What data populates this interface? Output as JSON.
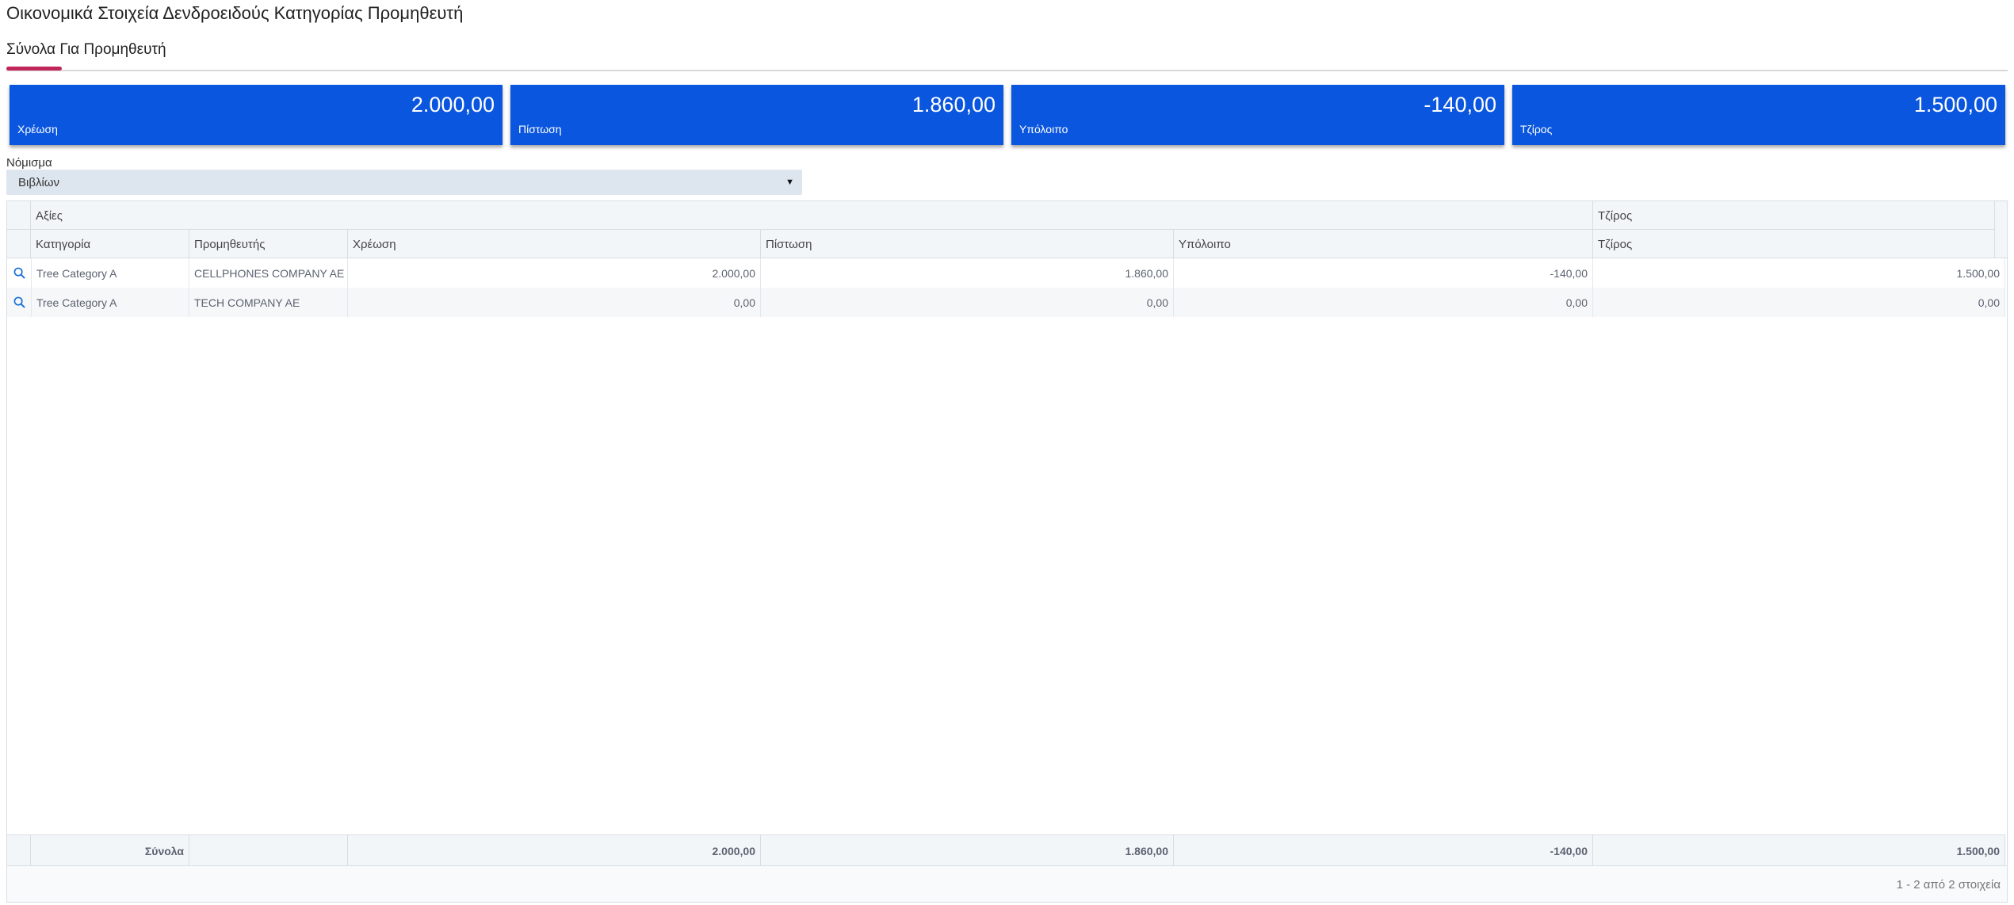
{
  "page": {
    "title": "Οικονομικά Στοιχεία Δενδροειδούς Κατηγορίας Προμηθευτή"
  },
  "tabs": [
    {
      "label": "Σύνολα Για Προμηθευτή",
      "active": true
    }
  ],
  "cards": [
    {
      "value": "2.000,00",
      "label": "Χρέωση"
    },
    {
      "value": "1.860,00",
      "label": "Πίστωση"
    },
    {
      "value": "-140,00",
      "label": "Υπόλοιπο"
    },
    {
      "value": "1.500,00",
      "label": "Τζίρος"
    }
  ],
  "currency": {
    "label": "Νόμισμα",
    "value": "Βιβλίων"
  },
  "grid": {
    "group_headers": {
      "values": "Αξίες",
      "turnover": "Τζίρος"
    },
    "columns": {
      "category": "Κατηγορία",
      "supplier": "Προμηθευτής",
      "debit": "Χρέωση",
      "credit": "Πίστωση",
      "balance": "Υπόλοιπο",
      "turnover": "Τζίρος"
    },
    "rows": [
      {
        "category": "Tree Category A",
        "supplier": "CELLPHONES COMPANY AE",
        "debit": "2.000,00",
        "credit": "1.860,00",
        "balance": "-140,00",
        "turnover": "1.500,00"
      },
      {
        "category": "Tree Category A",
        "supplier": "TECH COMPANY AE",
        "debit": "0,00",
        "credit": "0,00",
        "balance": "0,00",
        "turnover": "0,00"
      }
    ],
    "totals": {
      "label": "Σύνολα",
      "debit": "2.000,00",
      "credit": "1.860,00",
      "balance": "-140,00",
      "turnover": "1.500,00"
    },
    "pager": "1 - 2 από 2 στοιχεία"
  },
  "colors": {
    "card_bg": "#0a56df",
    "tab_accent": "#c0265a",
    "icon": "#1a6fd6"
  },
  "icons": {
    "row_action": "search-icon",
    "dropdown": "caret-down-icon"
  }
}
